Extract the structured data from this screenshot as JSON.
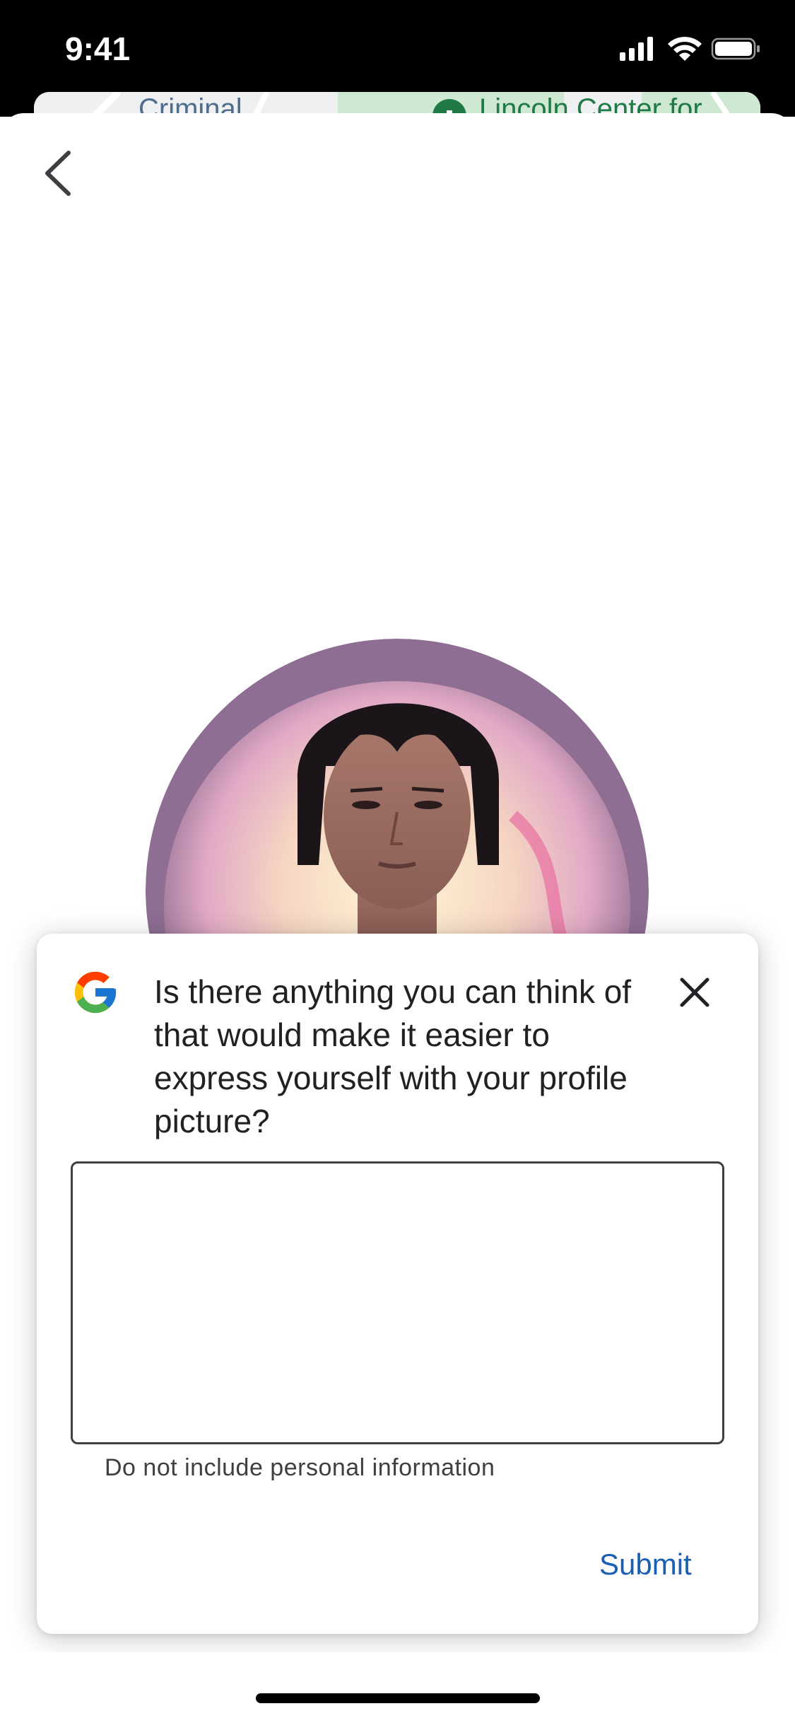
{
  "status_bar": {
    "time": "9:41",
    "icons": [
      "signal-icon",
      "wifi-icon",
      "battery-icon"
    ]
  },
  "map": {
    "label_left": "Criminal",
    "label_right": "Lincoln Center for"
  },
  "navigation": {
    "back_icon": "chevron-left-icon"
  },
  "feedback": {
    "logo": "google-g-logo",
    "question": "Is there anything you can think of that would make it easier to express yourself with your profile picture?",
    "response_value": "",
    "hint": "Do not include personal information",
    "submit_label": "Submit",
    "close_icon": "close-icon"
  },
  "colors": {
    "status_bar_bg": "#000000",
    "link_blue": "#1a5fb4",
    "text_primary": "#202124",
    "text_secondary": "#3c4043"
  }
}
